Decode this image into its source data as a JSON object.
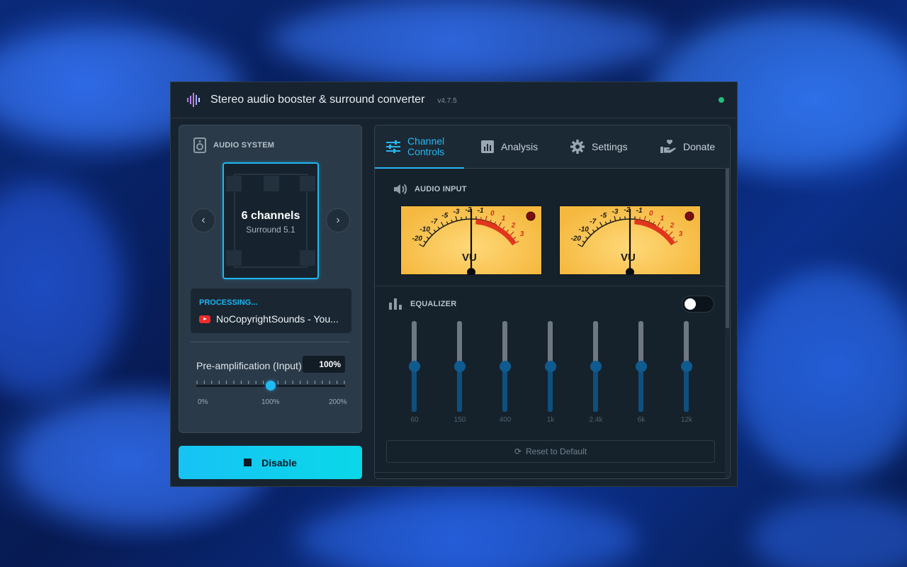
{
  "window": {
    "title": "Stereo audio booster & surround converter",
    "version": "v4.7.5",
    "status_color": "#21c07a"
  },
  "audio_system": {
    "heading": "AUDIO SYSTEM",
    "channels": "6 channels",
    "mode": "Surround 5.1",
    "prev_icon": "chevron-left-icon",
    "next_icon": "chevron-right-icon"
  },
  "processing": {
    "label": "PROCESSING...",
    "track": "NoCopyrightSounds - You...",
    "source_icon": "youtube-icon"
  },
  "preamp": {
    "label": "Pre-amplification (Input)",
    "value": "100%",
    "level_fraction": 0.5,
    "scale": [
      "0%",
      "100%",
      "200%"
    ]
  },
  "disable_button": {
    "label": "Disable",
    "icon": "stop-icon"
  },
  "tabs": [
    {
      "label1": "Channel",
      "label2": "Controls",
      "icon": "sliders-icon",
      "active": true
    },
    {
      "label": "Analysis",
      "icon": "chart-icon"
    },
    {
      "label": "Settings",
      "icon": "gear-icon"
    },
    {
      "label": "Donate",
      "icon": "donate-hand-icon"
    }
  ],
  "audio_input": {
    "heading": "AUDIO INPUT",
    "meter_label": "VU",
    "scale_top": [
      "-20",
      "-10",
      "-7",
      "-5",
      "-3",
      "-2",
      "-1",
      "0",
      "1",
      "2",
      "3"
    ]
  },
  "equalizer": {
    "heading": "EQUALIZER",
    "enabled": false,
    "bands": [
      {
        "freq": "60",
        "gain_fraction": 0.5
      },
      {
        "freq": "150",
        "gain_fraction": 0.5
      },
      {
        "freq": "400",
        "gain_fraction": 0.5
      },
      {
        "freq": "1k",
        "gain_fraction": 0.5
      },
      {
        "freq": "2.4k",
        "gain_fraction": 0.5
      },
      {
        "freq": "6k",
        "gain_fraction": 0.5
      },
      {
        "freq": "12k",
        "gain_fraction": 0.5
      }
    ],
    "reset_label": "Reset to Default"
  }
}
